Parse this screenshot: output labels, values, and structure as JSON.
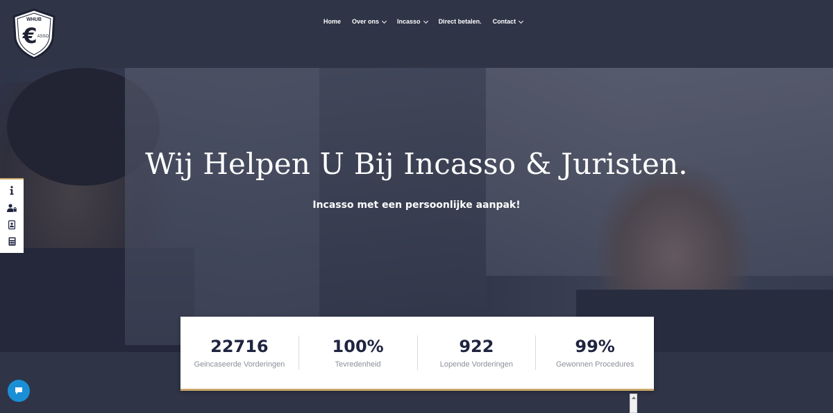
{
  "logo": {
    "text_top": "WHUB",
    "text_side": "ASSO",
    "symbol": "€"
  },
  "nav": {
    "items": [
      {
        "label": "Home",
        "has_dropdown": false
      },
      {
        "label": "Over ons",
        "has_dropdown": true
      },
      {
        "label": "Incasso",
        "has_dropdown": true
      },
      {
        "label": "Direct betalen.",
        "has_dropdown": false
      },
      {
        "label": "Contact",
        "has_dropdown": true
      }
    ]
  },
  "hero": {
    "title": "Wij Helpen U Bij Incasso & Juristen.",
    "subtitle": "Incasso met een persoonlijke aanpak!"
  },
  "side_tools": [
    "info-icon",
    "user-lock-icon",
    "id-card-icon",
    "calculator-icon"
  ],
  "stats": [
    {
      "value": "22716",
      "label": "Geincaseerde Vorderingen"
    },
    {
      "value": "100%",
      "label": "Tevredenheid"
    },
    {
      "value": "922",
      "label": "Lopende Vorderingen"
    },
    {
      "value": "99%",
      "label": "Gewonnen Procedures"
    }
  ],
  "colors": {
    "background": "#2f3447",
    "accent_gold": "#c9a86a",
    "stat_text": "#1f2440",
    "chat_blue": "#1a8fd6"
  }
}
